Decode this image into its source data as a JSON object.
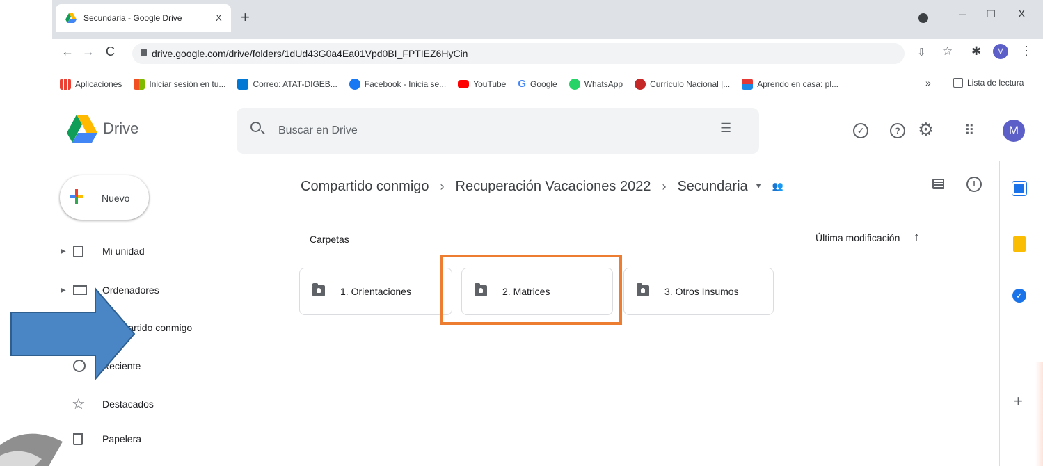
{
  "browser": {
    "tab_title": "Secundaria - Google Drive",
    "tab_close": "X",
    "new_tab": "+",
    "window_min": "–",
    "window_max": "❐",
    "window_close": "X",
    "url": "drive.google.com/drive/folders/1dUd43G0a4Ea01Vpd0BI_FPTIEZ6HyCin",
    "profile_initial": "M",
    "bookmarks": [
      {
        "label": "Aplicaciones",
        "color": "#1a73e8"
      },
      {
        "label": "Iniciar sesión en tu...",
        "color": "#f25022"
      },
      {
        "label": "Correo: ATAT-DIGEB...",
        "color": "#0078d4"
      },
      {
        "label": "Facebook - Inicia se...",
        "color": "#1877f2"
      },
      {
        "label": "YouTube",
        "color": "#ff0000"
      },
      {
        "label": "Google",
        "color": "#4285f4"
      },
      {
        "label": "WhatsApp",
        "color": "#25d366"
      },
      {
        "label": "Currículo Nacional |...",
        "color": "#c62828"
      },
      {
        "label": "Aprendo en casa: pl...",
        "color": "#e53935"
      }
    ],
    "more_bookmarks": "»",
    "reading_list": "Lista de lectura"
  },
  "drive": {
    "logo_text": "Drive",
    "search_placeholder": "Buscar en Drive",
    "avatar": "M",
    "new_button": "Nuevo",
    "nav": [
      {
        "label": "Mi unidad"
      },
      {
        "label": "Ordenadores"
      },
      {
        "label": "Compartido conmigo"
      },
      {
        "label": "Reciente"
      },
      {
        "label": "Destacados"
      },
      {
        "label": "Papelera"
      }
    ],
    "breadcrumb": [
      "Compartido conmigo",
      "Recuperación Vacaciones 2022",
      "Secundaria"
    ],
    "section_label": "Carpetas",
    "sort_label": "Última modificación",
    "sort_arrow": "↑",
    "folders": [
      "1. Orientaciones",
      "2. Matrices",
      "3. Otros Insumos"
    ],
    "side_add": "+"
  },
  "colors": {
    "highlight_box": "#ed7d31",
    "arrow_fill": "#4a86c5",
    "arrow_stroke": "#2e5f8f"
  }
}
